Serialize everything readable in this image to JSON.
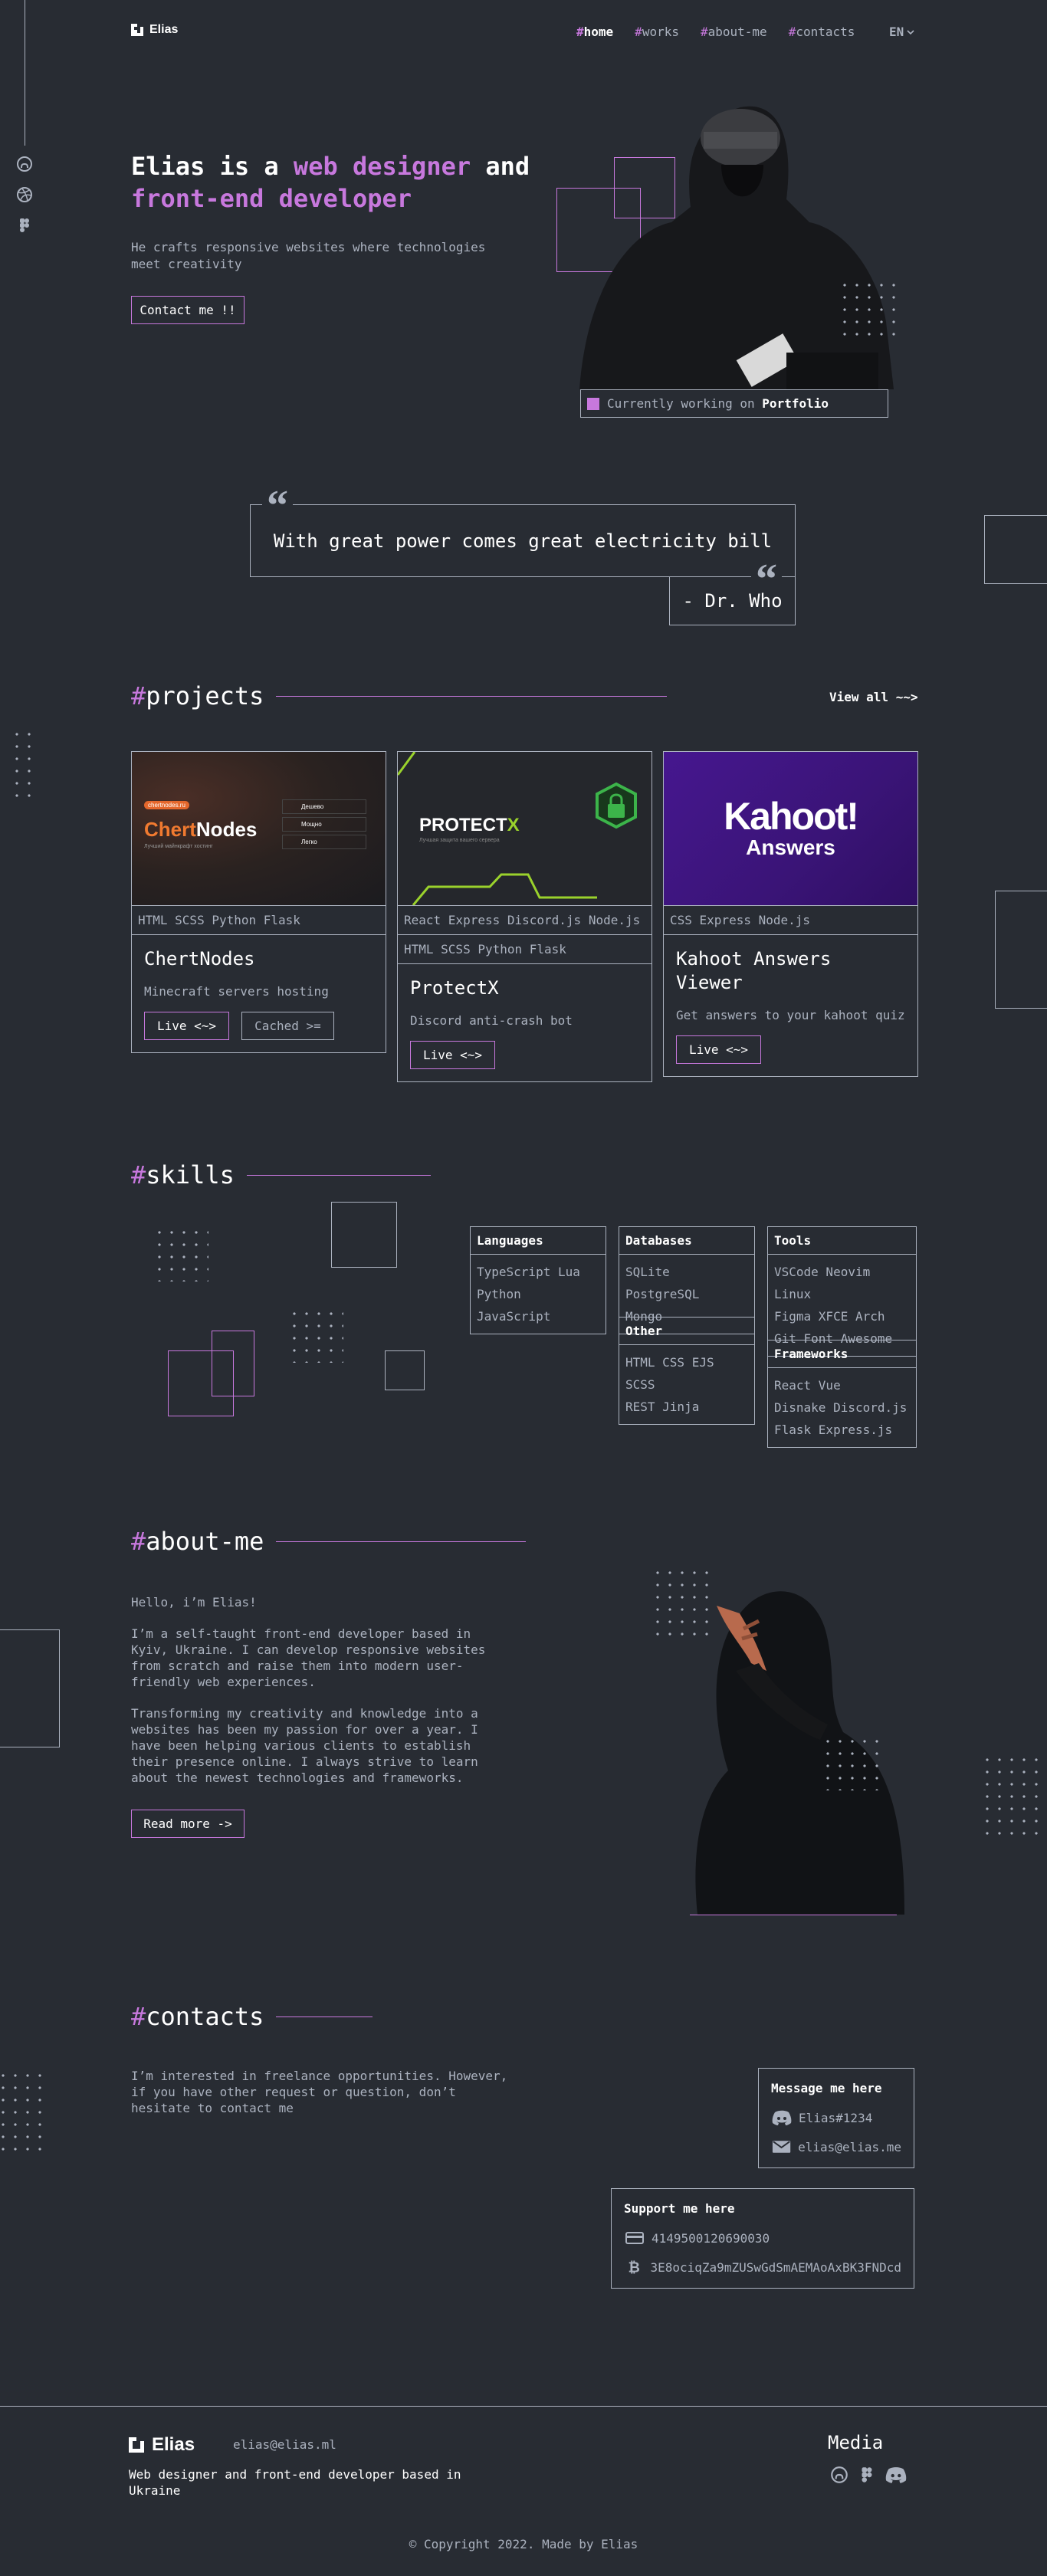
{
  "colors": {
    "background": "#282C33",
    "accent": "#C778DD",
    "gray": "#ABB2BF",
    "white": "#FFFFFF"
  },
  "header": {
    "logo": "Elias",
    "nav": [
      {
        "hash": "#",
        "label": "home"
      },
      {
        "hash": "#",
        "label": "works"
      },
      {
        "hash": "#",
        "label": "about-me"
      },
      {
        "hash": "#",
        "label": "contacts"
      }
    ],
    "lang": "EN"
  },
  "sidebar_icons": [
    "github-icon",
    "dribbble-icon",
    "figma-icon"
  ],
  "hero": {
    "title_a": "Elias is a ",
    "title_b": "web designer",
    "title_c": " and",
    "title_d": "front-end developer",
    "subtitle": "He crafts responsive websites where technologies meet creativity",
    "cta": "Contact me !!",
    "status_a": "Currently working on ",
    "status_b": "Portfolio"
  },
  "quote": {
    "text": "With great power comes great electricity bill",
    "author": "- Dr. Who"
  },
  "projects": {
    "hash": "#",
    "title": "projects",
    "view_all": "View all ~~>",
    "items": [
      {
        "tags": [
          "HTML SCSS Python Flask"
        ],
        "name": "ChertNodes",
        "desc": "Minecraft servers hosting",
        "buttons": [
          "Live <~>",
          "Cached >="
        ],
        "image": {
          "badge": "chertnodes.ru",
          "brand_a": "Chert",
          "brand_b": "Nodes",
          "tagline": "Лучший майнкрафт хостинг",
          "menu": [
            "Дешево",
            "Мощно",
            "Легко"
          ]
        }
      },
      {
        "tags": [
          "React Express Discord.js Node.js",
          "HTML SCSS Python Flask"
        ],
        "name": "ProtectX",
        "desc": "Discord anti-crash bot",
        "buttons": [
          "Live <~>"
        ],
        "image": {
          "brand_a": "PROTECT",
          "brand_b": "X",
          "tagline": "Лучшая защита вашего сервера"
        }
      },
      {
        "tags": [
          "CSS Express Node.js"
        ],
        "name": "Kahoot Answers Viewer",
        "desc": "Get answers to your kahoot quiz",
        "buttons": [
          "Live <~>"
        ],
        "image": {
          "brand_a": "Kahoot!",
          "brand_b": "Answers"
        }
      }
    ]
  },
  "skills": {
    "hash": "#",
    "title": "skills",
    "groups": {
      "languages": {
        "title": "Languages",
        "items": [
          "TypeScript Lua",
          "Python JavaScript"
        ]
      },
      "databases": {
        "title": "Databases",
        "items": [
          "SQLite PostgreSQL",
          "Mongo"
        ]
      },
      "tools": {
        "title": "Tools",
        "items": [
          "VSCode Neovim Linux",
          "Figma XFCE Arch",
          "Git Font Awesome"
        ]
      },
      "other": {
        "title": "Other",
        "items": [
          "HTML CSS EJS SCSS",
          "REST Jinja"
        ]
      },
      "frameworks": {
        "title": "Frameworks",
        "items": [
          "React Vue",
          "Disnake Discord.js",
          "Flask Express.js"
        ]
      }
    }
  },
  "about": {
    "hash": "#",
    "title": "about-me",
    "greeting": "Hello, i’m Elias!",
    "p1": "I’m a self-taught front-end developer based in Kyiv, Ukraine. I can develop responsive websites from scratch and raise them into modern user-friendly web experiences.",
    "p2": "Transforming my creativity and knowledge into a websites has been my passion for over a year. I have been helping various clients to establish their presence online. I always strive to learn about the newest technologies and frameworks.",
    "cta": "Read more ->"
  },
  "contacts": {
    "hash": "#",
    "title": "contacts",
    "text": "I’m interested in freelance opportunities. However, if you have other request or question, don’t hesitate to contact me",
    "message": {
      "title": "Message me here",
      "discord": "Elias#1234",
      "email": "elias@elias.me"
    },
    "support": {
      "title": "Support me here",
      "card": "4149500120690030",
      "btc": "3E8ociqZa9mZUSwGdSmAEMAoAxBK3FNDcd"
    }
  },
  "footer": {
    "logo": "Elias",
    "email": "elias@elias.ml",
    "tagline": "Web designer and front-end developer based in Ukraine",
    "media_title": "Media",
    "copyright": "© Copyright 2022. Made by Elias"
  }
}
